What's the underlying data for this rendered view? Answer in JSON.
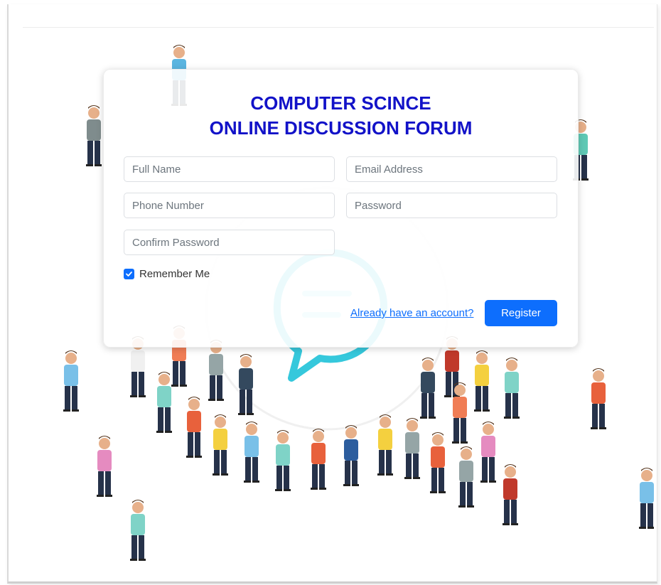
{
  "header": {
    "title_line1": "COMPUTER SCINCE",
    "title_line2": "ONLINE DISCUSSION FORUM"
  },
  "form": {
    "full_name_placeholder": "Full Name",
    "email_placeholder": "Email Address",
    "phone_placeholder": "Phone Number",
    "password_placeholder": "Password",
    "confirm_password_placeholder": "Confirm Password",
    "remember_label": "Remember Me",
    "remember_checked": true,
    "login_link": "Already have an account?",
    "register_label": "Register"
  },
  "background": {
    "illustration": "crowd-with-chat-bubble",
    "bubble_icon": "chat-bubble-icon",
    "bubble_color": "#35c8dc"
  },
  "colors": {
    "title": "#1212c8",
    "accent": "#0d6efd"
  }
}
